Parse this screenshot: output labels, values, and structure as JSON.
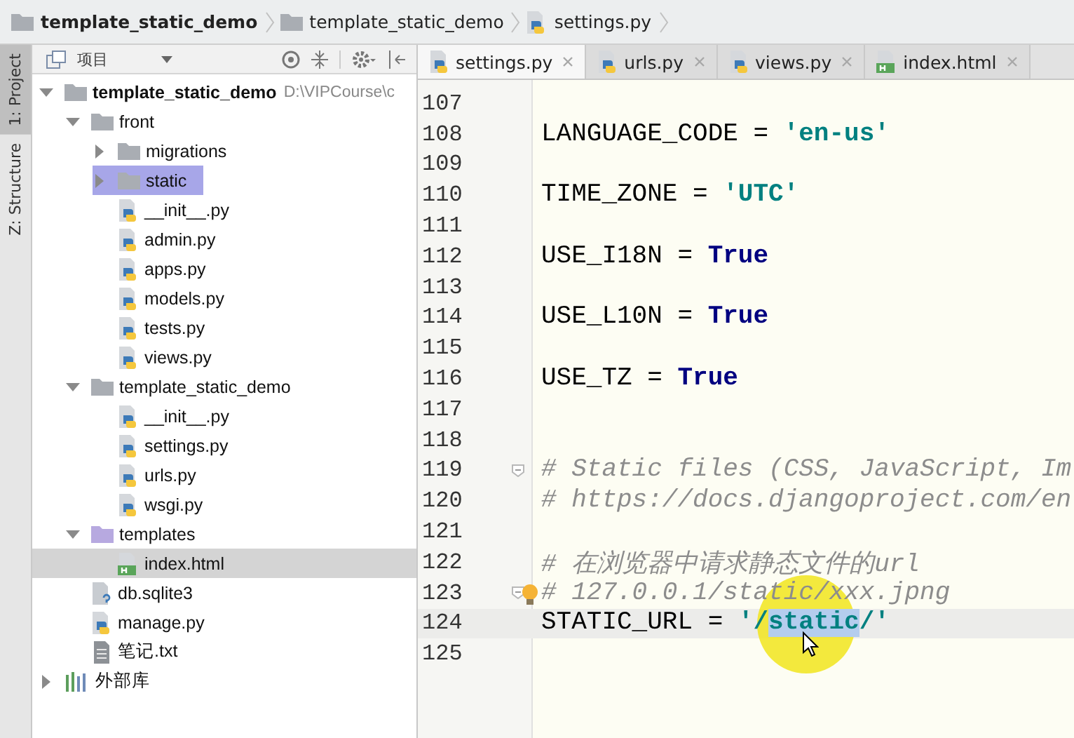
{
  "breadcrumbs": [
    {
      "label": "template_static_demo",
      "kind": "project"
    },
    {
      "label": "template_static_demo",
      "kind": "folder"
    },
    {
      "label": "settings.py",
      "kind": "py"
    }
  ],
  "tool_strip": [
    {
      "label": "1: Project",
      "selected": true
    },
    {
      "label": "Z: Structure",
      "selected": false
    }
  ],
  "project_panel": {
    "title": "项目",
    "tree": [
      {
        "label": "template_static_demo",
        "path": "D:\\VIPCourse\\c",
        "kind": "folder",
        "expanded": true,
        "selected": false,
        "highlighted": false,
        "children": [
          {
            "label": "front",
            "kind": "folder",
            "expanded": true,
            "selected": false,
            "highlighted": false,
            "children": [
              {
                "label": "migrations",
                "kind": "folder",
                "expanded": false,
                "selected": false,
                "highlighted": false
              },
              {
                "label": "static",
                "kind": "folder",
                "expanded": false,
                "selected": false,
                "highlighted": true
              },
              {
                "label": "__init__.py",
                "kind": "py",
                "selected": false,
                "highlighted": false
              },
              {
                "label": "admin.py",
                "kind": "py",
                "selected": false,
                "highlighted": false
              },
              {
                "label": "apps.py",
                "kind": "py",
                "selected": false,
                "highlighted": false
              },
              {
                "label": "models.py",
                "kind": "py",
                "selected": false,
                "highlighted": false
              },
              {
                "label": "tests.py",
                "kind": "py",
                "selected": false,
                "highlighted": false
              },
              {
                "label": "views.py",
                "kind": "py",
                "selected": false,
                "highlighted": false
              }
            ]
          },
          {
            "label": "template_static_demo",
            "kind": "folder",
            "expanded": true,
            "selected": false,
            "highlighted": false,
            "children": [
              {
                "label": "__init__.py",
                "kind": "py",
                "selected": false,
                "highlighted": false
              },
              {
                "label": "settings.py",
                "kind": "py",
                "selected": false,
                "highlighted": false
              },
              {
                "label": "urls.py",
                "kind": "py",
                "selected": false,
                "highlighted": false
              },
              {
                "label": "wsgi.py",
                "kind": "py",
                "selected": false,
                "highlighted": false
              }
            ]
          },
          {
            "label": "templates",
            "kind": "templates",
            "expanded": true,
            "selected": false,
            "highlighted": false,
            "children": [
              {
                "label": "index.html",
                "kind": "html",
                "selected": true,
                "highlighted": false
              }
            ]
          },
          {
            "label": "db.sqlite3",
            "kind": "db",
            "selected": false,
            "highlighted": false
          },
          {
            "label": "manage.py",
            "kind": "py",
            "selected": false,
            "highlighted": false
          },
          {
            "label": "笔记.txt",
            "kind": "txt",
            "selected": false,
            "highlighted": false
          }
        ]
      },
      {
        "label": "外部库",
        "kind": "library",
        "expanded": false,
        "selected": false,
        "highlighted": false
      }
    ]
  },
  "editor": {
    "tabs": [
      {
        "label": "settings.py",
        "kind": "py",
        "selected": true
      },
      {
        "label": "urls.py",
        "kind": "py",
        "selected": false
      },
      {
        "label": "views.py",
        "kind": "py",
        "selected": false
      },
      {
        "label": "index.html",
        "kind": "html",
        "selected": false
      }
    ],
    "lines": [
      {
        "number": "107",
        "current": false,
        "fold": false,
        "bulb": false
      },
      {
        "number": "108",
        "current": false,
        "fold": false,
        "bulb": false,
        "segments": [
          {
            "text": "LANGUAGE_CODE = ",
            "kind": "plain",
            "selected": false
          },
          {
            "text": "'en-us'",
            "kind": "string",
            "selected": false
          }
        ]
      },
      {
        "number": "109",
        "current": false,
        "fold": false,
        "bulb": false
      },
      {
        "number": "110",
        "current": false,
        "fold": false,
        "bulb": false,
        "segments": [
          {
            "text": "TIME_ZONE = ",
            "kind": "plain",
            "selected": false
          },
          {
            "text": "'UTC'",
            "kind": "string",
            "selected": false
          }
        ]
      },
      {
        "number": "111",
        "current": false,
        "fold": false,
        "bulb": false
      },
      {
        "number": "112",
        "current": false,
        "fold": false,
        "bulb": false,
        "segments": [
          {
            "text": "USE_I18N = ",
            "kind": "plain",
            "selected": false
          },
          {
            "text": "True",
            "kind": "keyword",
            "selected": false
          }
        ]
      },
      {
        "number": "113",
        "current": false,
        "fold": false,
        "bulb": false
      },
      {
        "number": "114",
        "current": false,
        "fold": false,
        "bulb": false,
        "segments": [
          {
            "text": "USE_L10N = ",
            "kind": "plain",
            "selected": false
          },
          {
            "text": "True",
            "kind": "keyword",
            "selected": false
          }
        ]
      },
      {
        "number": "115",
        "current": false,
        "fold": false,
        "bulb": false
      },
      {
        "number": "116",
        "current": false,
        "fold": false,
        "bulb": false,
        "segments": [
          {
            "text": "USE_TZ = ",
            "kind": "plain",
            "selected": false
          },
          {
            "text": "True",
            "kind": "keyword",
            "selected": false
          }
        ]
      },
      {
        "number": "117",
        "current": false,
        "fold": false,
        "bulb": false
      },
      {
        "number": "118",
        "current": false,
        "fold": false,
        "bulb": false
      },
      {
        "number": "119",
        "current": false,
        "fold": true,
        "bulb": false,
        "segments": [
          {
            "text": "# Static files (CSS, JavaScript, Im",
            "kind": "comment",
            "selected": false
          }
        ]
      },
      {
        "number": "120",
        "current": false,
        "fold": false,
        "bulb": false,
        "segments": [
          {
            "text": "# https://docs.djangoproject.com/en",
            "kind": "comment",
            "selected": false
          }
        ]
      },
      {
        "number": "121",
        "current": false,
        "fold": false,
        "bulb": false
      },
      {
        "number": "122",
        "current": false,
        "fold": false,
        "bulb": false,
        "segments": [
          {
            "text": "# 在浏览器中请求静态文件的url",
            "kind": "comment",
            "selected": false
          }
        ]
      },
      {
        "number": "123",
        "current": false,
        "fold": true,
        "bulb": true,
        "segments": [
          {
            "text": "# 127.0.0.1/static/xxx.jpng",
            "kind": "comment",
            "selected": false
          }
        ]
      },
      {
        "number": "124",
        "current": true,
        "fold": false,
        "bulb": false,
        "segments": [
          {
            "text": "STATIC_URL = ",
            "kind": "plain",
            "selected": false
          },
          {
            "text": "'/",
            "kind": "string",
            "selected": false
          },
          {
            "text": "static",
            "kind": "string",
            "selected": true
          },
          {
            "text": "/'",
            "kind": "string",
            "selected": false
          }
        ]
      },
      {
        "number": "125",
        "current": false,
        "fold": false,
        "bulb": false
      }
    ]
  }
}
